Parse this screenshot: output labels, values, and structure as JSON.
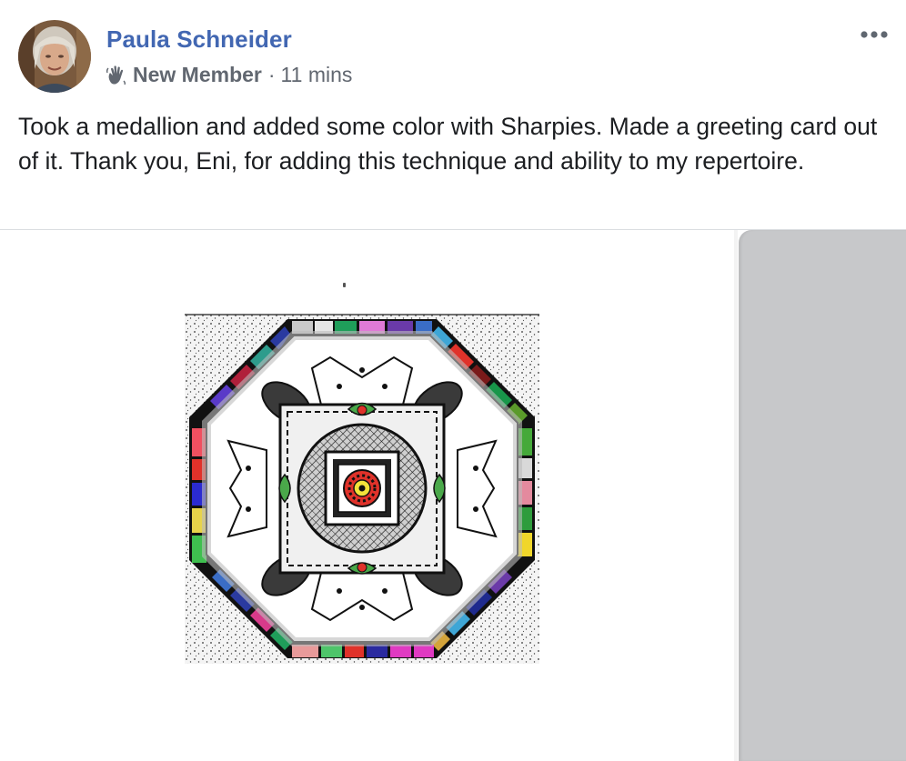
{
  "post": {
    "author": "Paula Schneider",
    "badge": "New Member",
    "separator": "·",
    "time": "11 mins",
    "text": "Took a medallion and added some color with Sharpies. Made a greeting card out of it. Thank you, Eni, for adding this technique and ability to my repertoire."
  },
  "icons": {
    "badge": "waving-hand-icon",
    "more": "more-options-icon",
    "avatar": "user-avatar"
  },
  "colors": {
    "author_link": "#4267b2",
    "meta_text": "#616770",
    "body_text": "#1c1e21",
    "side_photo": "#c7c8ca"
  }
}
